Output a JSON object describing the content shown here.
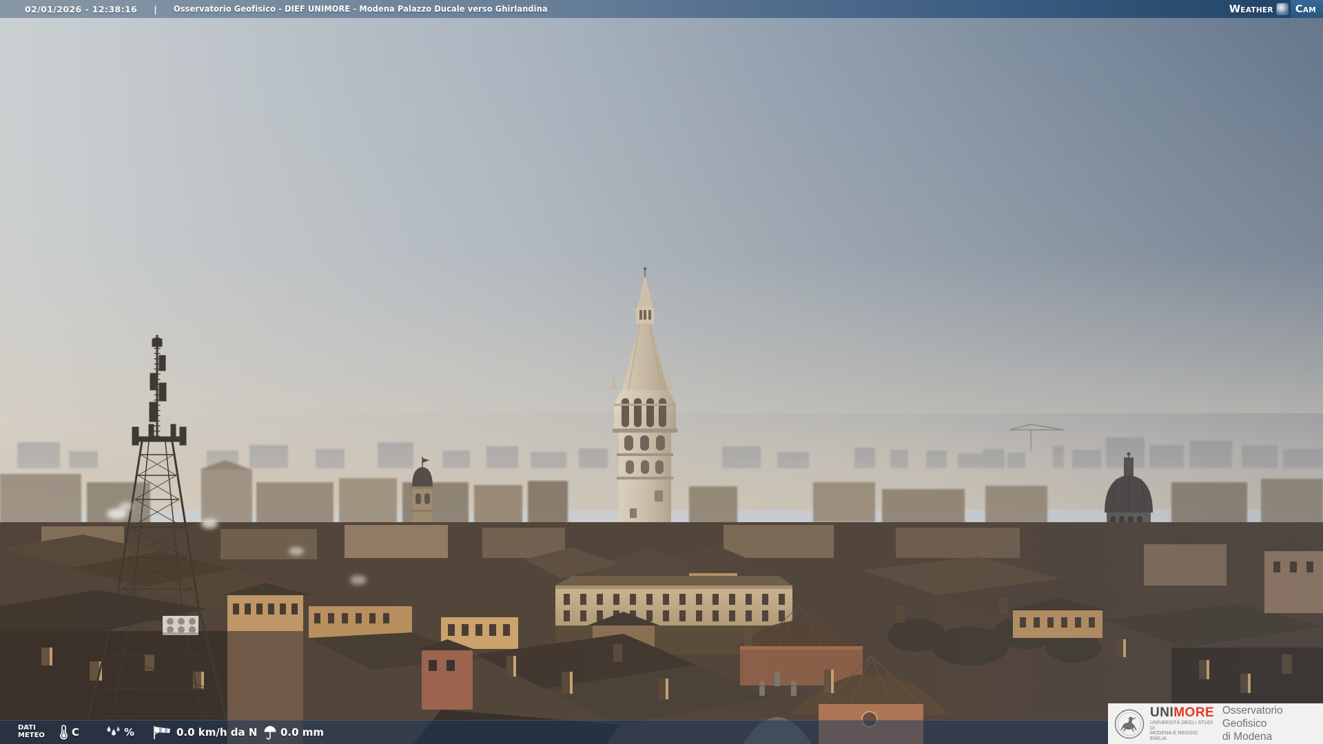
{
  "header": {
    "datetime": "02/01/2026 - 12:38:16",
    "separator": "|",
    "title": "Osservatorio Geofisico - DIEF UNIMORE - Modena Palazzo Ducale verso Ghirlandina",
    "weathercam": {
      "word1_initial": "W",
      "word1_rest": "EATHER",
      "word2_initial": "C",
      "word2_rest": "AM"
    }
  },
  "footer": {
    "label_line1": "DATI",
    "label_line2": "METEO",
    "temperature_unit": "C",
    "humidity_unit": "%",
    "wind_value": "0.0 km/h da N",
    "rain_value": "0.0 mm"
  },
  "logo": {
    "brand_uni": "UNI",
    "brand_more": "MORE",
    "university_line1": "UNIVERSITÀ DEGLI STUDI DI",
    "university_line2": "MODENA E REGGIO EMILIA",
    "observatory_line1": "Osservatorio Geofisico",
    "observatory_line2": "di Modena"
  },
  "colors": {
    "header_bar_left": "#8797a5",
    "header_bar_right": "#1f4164",
    "weathercam_badge_blue": "#2f6496",
    "footer_overlay": "rgba(23,52,88,0.52)",
    "unimore_red": "#e63a23",
    "logo_background": "#f1f1ef",
    "sky_top_left": "#cbd1d4",
    "sky_top_right": "#5e7289",
    "horizon_haze": "#d9cfbe"
  }
}
